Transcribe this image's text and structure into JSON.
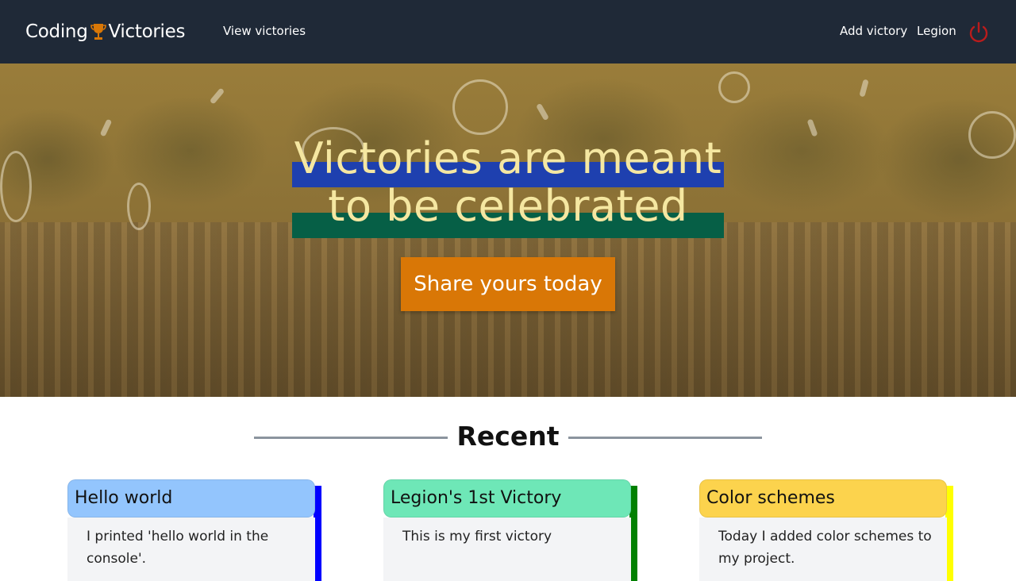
{
  "navbar": {
    "brand_left": "Coding",
    "brand_right": "Victories",
    "view_link": "View victories",
    "add_link": "Add victory",
    "legion_link": "Legion",
    "icons": {
      "brand": "trophy-icon",
      "logout": "power-icon"
    }
  },
  "hero": {
    "title_line1": "Victories are meant",
    "title_line2": "to be celebrated",
    "cta": "Share yours today",
    "colors": {
      "band_top": "#1e40af",
      "band_bottom": "#065f46",
      "cta": "#d97706",
      "title": "#f5e7a1"
    }
  },
  "recent": {
    "heading": "Recent",
    "cards": [
      {
        "title": "Hello world",
        "body": "I printed 'hello world in the console'.",
        "header_color": "#93c5fd",
        "edge_color": "#0000ff"
      },
      {
        "title": "Legion's 1st Victory",
        "body": "This is my first victory",
        "header_color": "#6ee7b7",
        "edge_color": "#008000"
      },
      {
        "title": "Color schemes",
        "body": "Today I added color schemes to my project.",
        "header_color": "#fcd34d",
        "edge_color": "#ffff00"
      }
    ]
  }
}
